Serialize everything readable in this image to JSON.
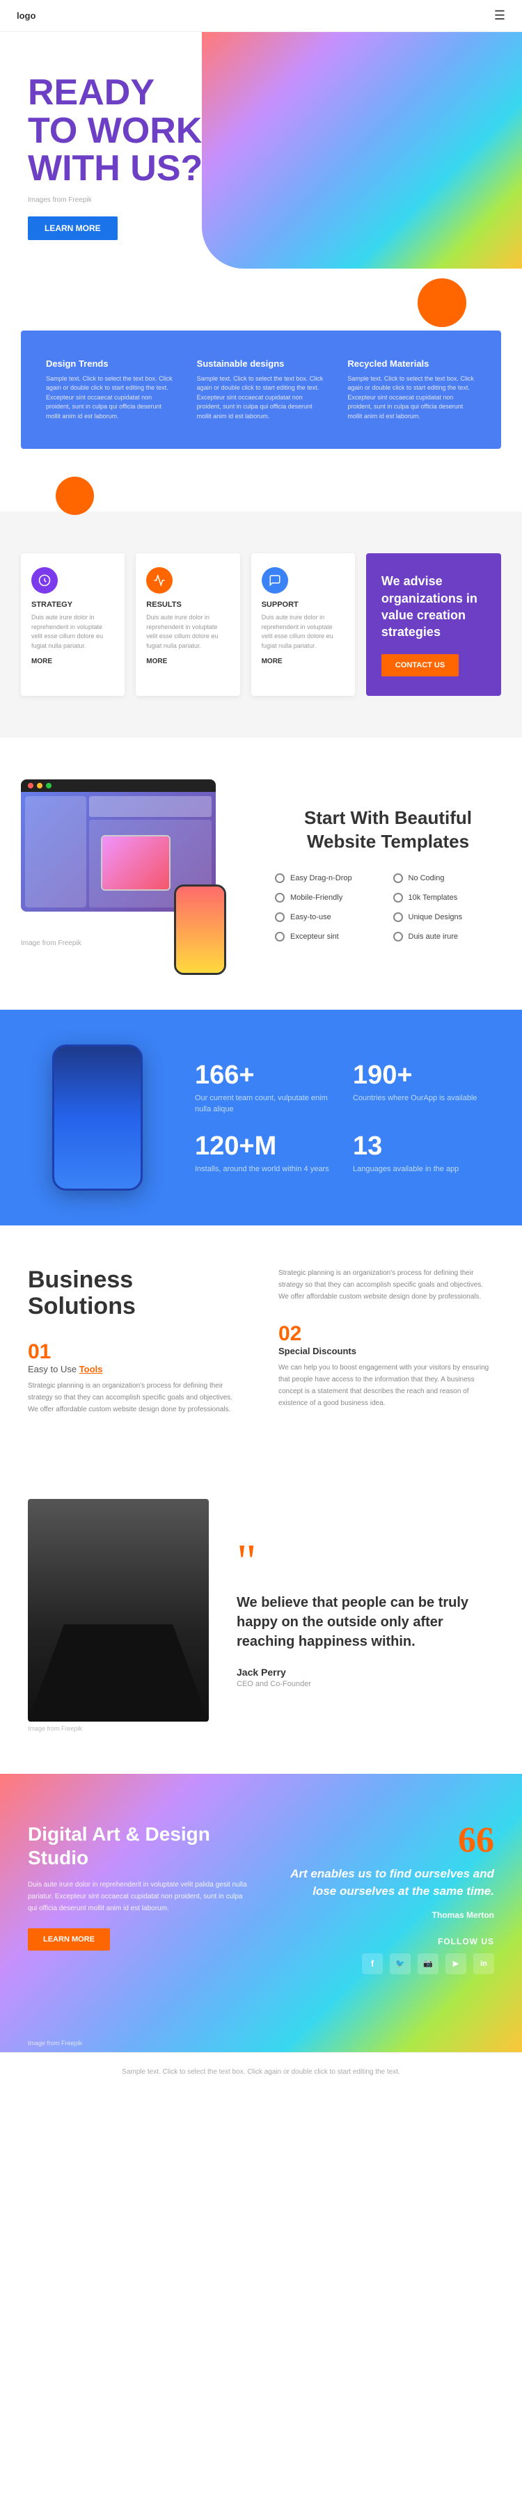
{
  "nav": {
    "logo": "logo",
    "hamburger_icon": "☰"
  },
  "hero": {
    "title_line1": "READY",
    "title_line2": "TO WORK",
    "title_line3": "WITH US?",
    "image_credit": "Images from Freepik",
    "btn_label": "LEARN MORE"
  },
  "features_section": {
    "items": [
      {
        "title": "Design Trends",
        "text": "Sample text. Click to select the text box. Click again or double click to start editing the text. Excepteur sint occaecat cupidatat non proident, sunt in culpa qui officia deserunt mollit anim id est laborum."
      },
      {
        "title": "Sustainable designs",
        "text": "Sample text. Click to select the text box. Click again or double click to start editing the text. Excepteur sint occaecat cupidatat non proident, sunt in culpa qui officia deserunt mollit anim id est laborum."
      },
      {
        "title": "Recycled Materials",
        "text": "Sample text. Click to select the text box. Click again or double click to start editing the text. Excepteur sint occaecat cupidatat non proident, sunt in culpa qui officia deserunt mollit anim id est laborum."
      }
    ]
  },
  "strategy_section": {
    "cards": [
      {
        "title": "STRATEGY",
        "text": "Duis aute irure dolor in reprehenderit in voluptate velit esse cillum dolore eu fugiat nulla pariatur.",
        "more": "MORE"
      },
      {
        "title": "RESULTS",
        "text": "Duis aute irure dolor in reprehenderit in voluptate velit esse cillum dolore eu fugiat nulla pariatur.",
        "more": "MORE"
      },
      {
        "title": "SUPPORT",
        "text": "Duis aute irure dolor in reprehenderit in voluptate velit esse cillum dolore eu fugiat nulla pariatur.",
        "more": "MORE"
      }
    ],
    "right_title": "We advise organizations in value creation strategies",
    "contact_btn": "CONTACT US"
  },
  "templates_section": {
    "title": "Start With Beautiful Website Templates",
    "image_credit": "Image from Freepik",
    "features": [
      "Easy Drag-n-Drop",
      "No Coding",
      "Mobile-Friendly",
      "10k Templates",
      "Easy-to-use",
      "Unique Designs",
      "Excepteur sint",
      "Duis aute irure"
    ]
  },
  "stats_section": {
    "items": [
      {
        "value": "166+",
        "desc": "Our current team count, vulputate enim nulla alique"
      },
      {
        "value": "190+",
        "desc": "Countries where OurApp is available"
      },
      {
        "value": "120+M",
        "desc": "Installs, around the world within 4 years"
      },
      {
        "value": "13",
        "desc": "Languages available in the app"
      }
    ]
  },
  "business_section": {
    "title": "Business Solutions",
    "left_items": [
      {
        "number": "01",
        "subtitle_prefix": "Easy to Use ",
        "subtitle_highlight": "Tools",
        "text": "Strategic planning is an organization's process for defining their strategy so that they can accomplish specific goals and objectives. We offer affordable custom website design done by professionals."
      }
    ],
    "right_intro": "Strategic planning is an organization's process for defining their strategy so that they can accomplish specific goals and objectives. We offer affordable custom website design done by professionals.",
    "right_items": [
      {
        "number": "02",
        "title": "Special Discounts",
        "text": "We can help you to boost engagement with your visitors by ensuring that people have access to the information that they. A business concept is a statement that describes the reach and reason of existence of a good business idea."
      }
    ]
  },
  "quote_section": {
    "image_credit": "Image from Freepik",
    "quote_mark": "\"",
    "text": "We believe that people can be truly happy on the outside only after reaching happiness within.",
    "author": "Jack Perry",
    "role": "CEO and Co-Founder"
  },
  "art_section": {
    "title": "Digital Art & Design Studio",
    "text": "Duis aute irure dolor in reprehenderit in voluptate velit palida gesit nulla pariatur. Excepteur sint occaecat cupidatat non proident, sunt in culpa qui officia deserunt mollit anim id est laborum.",
    "btn_label": "LEARN MORE",
    "quote_mark": "66",
    "quote_text": "Art enables us to find ourselves and lose ourselves at the same time.",
    "quote_author": "Thomas Merton",
    "social_label": "FOLLOW US",
    "social_icons": [
      "f",
      "🐦",
      "📷",
      "▶",
      "in"
    ],
    "image_credit": "Image from Freepik"
  },
  "footer": {
    "text": "Sample text. Click to select the text box. Click again or double click to start editing the text."
  }
}
